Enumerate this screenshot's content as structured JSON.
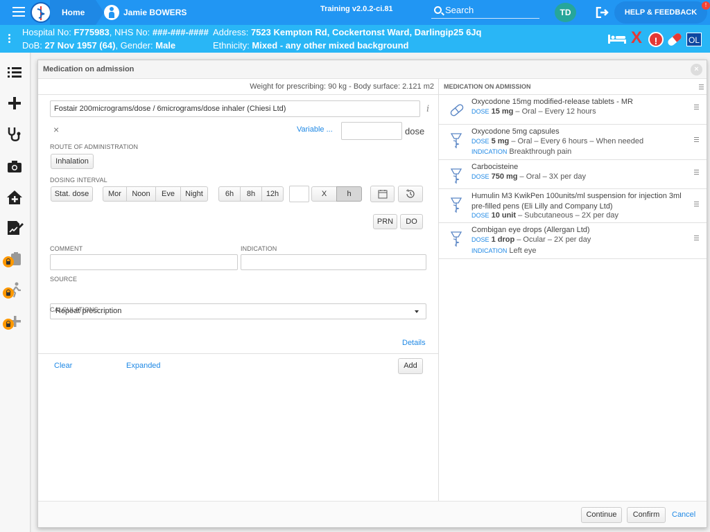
{
  "topbar": {
    "home_label": "Home",
    "patient_name": "Jamie BOWERS",
    "version": "Training v2.0.2-ci.81",
    "search_label": "Search",
    "user_initials": "TD",
    "help_label": "HELP & FEEDBACK",
    "help_badge": "!"
  },
  "banner": {
    "hospital_prefix": "Hospital No:",
    "hospital_no": "F775983",
    "nhs_prefix": ", NHS No:",
    "nhs_no": "###-###-####",
    "address_prefix": "Address:",
    "address": "7523 Kempton Rd, Cockertonst Ward, Darlingip25 6Jq",
    "dob_prefix": "DoB:",
    "dob": "27 Nov 1957 (64)",
    "gender_prefix": ", Gender:",
    "gender": "Male",
    "ethnicity_prefix": "Ethnicity:",
    "ethnicity": "Mixed - any other mixed background",
    "redx": "X",
    "alert": "!",
    "ol": "OL"
  },
  "modal": {
    "title": "Medication on admission",
    "close_glyph": "×",
    "weight_text": "Weight for prescribing: 90 kg - Body surface: 2.121 m2",
    "drug_value": "Fostair 200micrograms/dose / 6micrograms/dose inhaler (Chiesi Ltd)",
    "info_glyph": "i",
    "clear_glyph": "×",
    "variable_label": "Variable ...",
    "dose_label": "dose",
    "route_label": "ROUTE OF ADMINISTRATION",
    "route_button": "Inhalation",
    "interval_label": "DOSING INTERVAL",
    "stat_dose": "Stat. dose",
    "times": [
      "Mor",
      "Noon",
      "Eve",
      "Night"
    ],
    "hours": [
      "6h",
      "8h",
      "12h"
    ],
    "x_label": "X",
    "h_label": "h",
    "prn": "PRN",
    "do": "DO",
    "comment_label": "COMMENT",
    "indication_label": "INDICATION",
    "source_label": "SOURCE",
    "source_value": "Repeat prescription",
    "calculations_label": "CALCULATIONS",
    "details_link": "Details",
    "clear_link": "Clear",
    "expanded_link": "Expanded",
    "add_button": "Add",
    "continue_button": "Continue",
    "confirm_button": "Confirm",
    "cancel_link": "Cancel"
  },
  "admission_list": {
    "title": "MEDICATION ON ADMISSION",
    "dose_tag": "DOSE",
    "indication_tag": "INDICATION",
    "items": [
      {
        "name": "Oxycodone 15mg modified-release tablets - MR",
        "dose": "15 mg",
        "detail": " – Oral – Every 12 hours",
        "icon": "capsule-icon"
      },
      {
        "name": "Oxycodone 5mg capsules",
        "dose": "5 mg",
        "detail": " – Oral – Every 6 hours – When needed",
        "indication": "Breakthrough pain",
        "icon": "pharmacy-icon"
      },
      {
        "name": "Carbocisteine",
        "dose": "750 mg",
        "detail": " – Oral – 3X per day",
        "icon": "pharmacy-icon"
      },
      {
        "name": "Humulin M3 KwikPen 100units/ml suspension for injection 3ml pre-filled pens (Eli Lilly and Company Ltd)",
        "dose": "10 unit",
        "detail": " – Subcutaneous – 2X per day",
        "icon": "pharmacy-icon"
      },
      {
        "name": "Combigan eye drops (Allergan Ltd)",
        "dose": "1 drop",
        "detail": " – Ocular – 2X per day",
        "indication": "Left eye",
        "icon": "pharmacy-icon"
      }
    ]
  }
}
